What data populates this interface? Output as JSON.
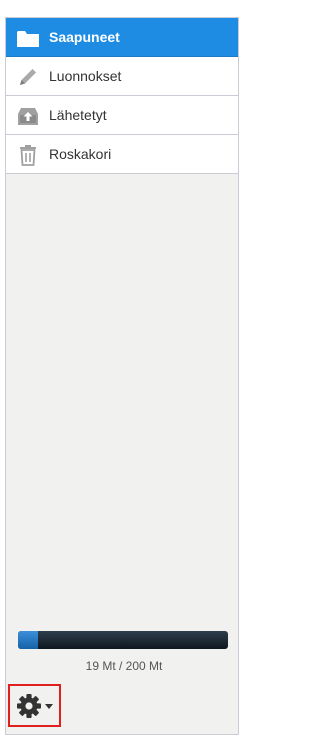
{
  "folders": [
    {
      "label": "Saapuneet",
      "icon": "folder-icon",
      "selected": true
    },
    {
      "label": "Luonnokset",
      "icon": "pencil-icon",
      "selected": false
    },
    {
      "label": "Lähetetyt",
      "icon": "outbox-icon",
      "selected": false
    },
    {
      "label": "Roskakori",
      "icon": "trash-icon",
      "selected": false
    }
  ],
  "quota": {
    "text": "19 Mt / 200 Mt",
    "used_fraction": 0.095
  },
  "settings": {
    "icon": "gear-icon",
    "menu_icon": "caret-down-icon"
  },
  "colors": {
    "selected_bg": "#1e8ce3",
    "highlight_border": "#e0201f"
  }
}
